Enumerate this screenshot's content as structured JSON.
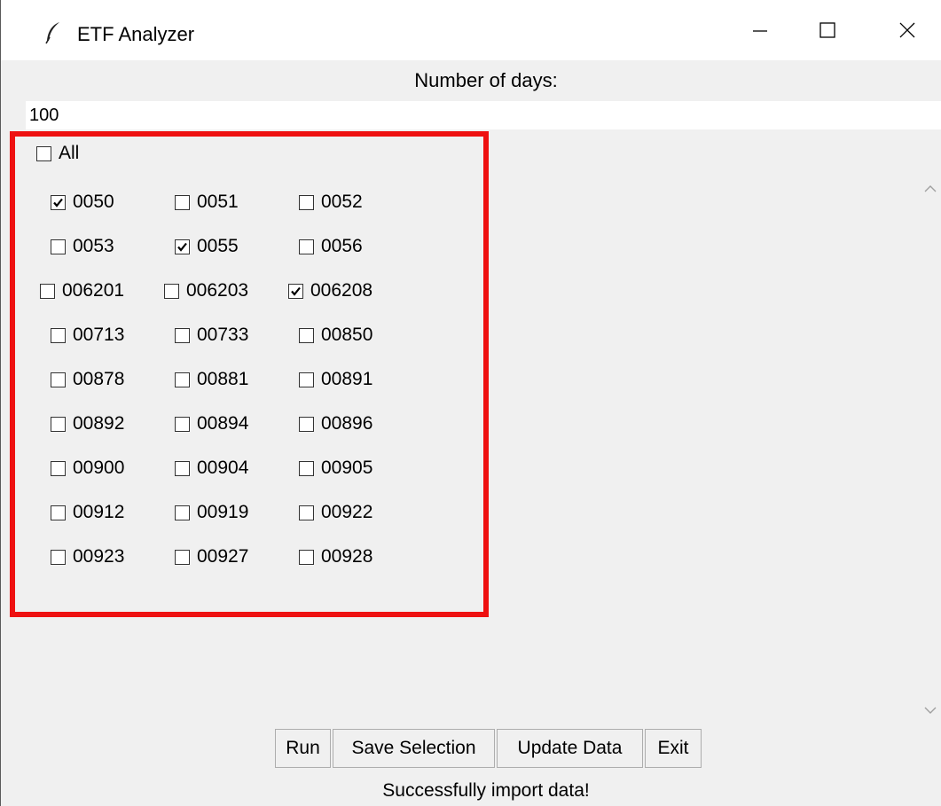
{
  "window": {
    "title": "ETF Analyzer"
  },
  "days": {
    "label": "Number of days:",
    "value": "100"
  },
  "all_checkbox": {
    "label": "All",
    "checked": false
  },
  "etfs": [
    {
      "code": "0050",
      "checked": true
    },
    {
      "code": "0051",
      "checked": false
    },
    {
      "code": "0052",
      "checked": false
    },
    {
      "code": "0053",
      "checked": false
    },
    {
      "code": "0055",
      "checked": true
    },
    {
      "code": "0056",
      "checked": false
    },
    {
      "code": "006201",
      "checked": false
    },
    {
      "code": "006203",
      "checked": false
    },
    {
      "code": "006208",
      "checked": true
    },
    {
      "code": "00713",
      "checked": false
    },
    {
      "code": "00733",
      "checked": false
    },
    {
      "code": "00850",
      "checked": false
    },
    {
      "code": "00878",
      "checked": false
    },
    {
      "code": "00881",
      "checked": false
    },
    {
      "code": "00891",
      "checked": false
    },
    {
      "code": "00892",
      "checked": false
    },
    {
      "code": "00894",
      "checked": false
    },
    {
      "code": "00896",
      "checked": false
    },
    {
      "code": "00900",
      "checked": false
    },
    {
      "code": "00904",
      "checked": false
    },
    {
      "code": "00905",
      "checked": false
    },
    {
      "code": "00912",
      "checked": false
    },
    {
      "code": "00919",
      "checked": false
    },
    {
      "code": "00922",
      "checked": false
    },
    {
      "code": "00923",
      "checked": false
    },
    {
      "code": "00927",
      "checked": false
    },
    {
      "code": "00928",
      "checked": false
    }
  ],
  "buttons": {
    "run": "Run",
    "save": "Save Selection",
    "update": "Update Data",
    "exit": "Exit"
  },
  "status": "Successfully import data!",
  "colors": {
    "highlight": "#ee1111",
    "window_bg": "#f0f0f0"
  },
  "icons": {
    "title": "feather-icon",
    "minimize": "minimize-icon",
    "maximize": "maximize-icon",
    "close": "close-icon",
    "scroll_up": "chevron-up-icon",
    "scroll_down": "chevron-down-icon"
  }
}
